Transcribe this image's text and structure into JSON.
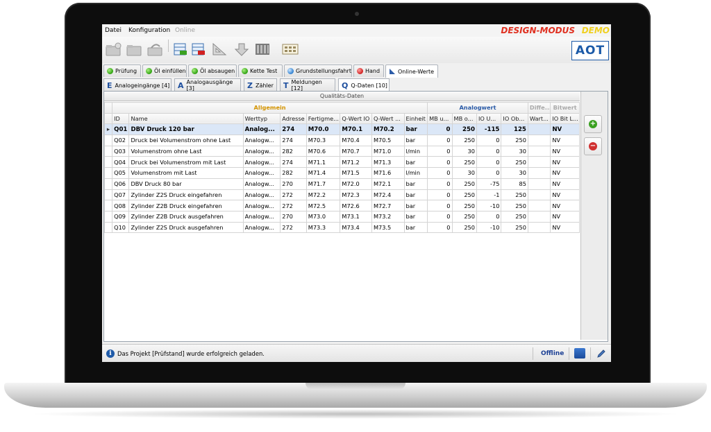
{
  "menu": {
    "items": [
      "Datei",
      "Konfiguration",
      "Online"
    ]
  },
  "mode": {
    "design": "DESIGN-MODUS",
    "demo": "DEMO"
  },
  "logo": {
    "text": "AOT"
  },
  "tabs": [
    "Prüfung",
    "Öl einfüllen",
    "Öl absaugen",
    "Kette Test",
    "Grundstellungsfahrt",
    "Hand",
    "Online-Werte"
  ],
  "subtabs": [
    {
      "glyph": "E",
      "label": "Analogeingänge [4]"
    },
    {
      "glyph": "A",
      "label": "Analogausgänge [3]"
    },
    {
      "glyph": "Z",
      "label": "Zähler"
    },
    {
      "glyph": "T",
      "label": "Meldungen [12]"
    },
    {
      "glyph": "Q",
      "label": "Q-Daten [10]"
    }
  ],
  "grid": {
    "title": "Qualitäts-Daten",
    "groups": {
      "allgemein": "Allgemein",
      "analogwert": "Analogwert",
      "differenz": "Diffe...",
      "bitwert": "Bitwert"
    },
    "columns": [
      "ID",
      "Name",
      "Werttyp",
      "Adresse",
      "Fertigme...",
      "Q-Wert IO",
      "Q-Wert ...",
      "Einheit",
      "MB u...",
      "MB o...",
      "IO U...",
      "IO Ob...",
      "Wart...",
      "IO Bit L..."
    ],
    "rows": [
      [
        "Q01",
        "DBV Druck 120 bar",
        "Analog...",
        "274",
        "M70.0",
        "M70.1",
        "M70.2",
        "bar",
        "0",
        "250",
        "-115",
        "125",
        "",
        "NV"
      ],
      [
        "Q02",
        "Druck bei Volumenstrom ohne Last",
        "Analogw...",
        "274",
        "M70.3",
        "M70.4",
        "M70.5",
        "bar",
        "0",
        "250",
        "0",
        "250",
        "",
        "NV"
      ],
      [
        "Q03",
        "Volumenstrom ohne Last",
        "Analogw...",
        "282",
        "M70.6",
        "M70.7",
        "M71.0",
        "l/min",
        "0",
        "30",
        "0",
        "30",
        "",
        "NV"
      ],
      [
        "Q04",
        "Druck bei Volumenstrom mit Last",
        "Analogw...",
        "274",
        "M71.1",
        "M71.2",
        "M71.3",
        "bar",
        "0",
        "250",
        "0",
        "250",
        "",
        "NV"
      ],
      [
        "Q05",
        "Volumenstrom mit Last",
        "Analogw...",
        "282",
        "M71.4",
        "M71.5",
        "M71.6",
        "l/min",
        "0",
        "30",
        "0",
        "30",
        "",
        "NV"
      ],
      [
        "Q06",
        "DBV Druck 80 bar",
        "Analogw...",
        "270",
        "M71.7",
        "M72.0",
        "M72.1",
        "bar",
        "0",
        "250",
        "-75",
        "85",
        "",
        "NV"
      ],
      [
        "Q07",
        "Zylinder Z2S Druck eingefahren",
        "Analogw...",
        "272",
        "M72.2",
        "M72.3",
        "M72.4",
        "bar",
        "0",
        "250",
        "-1",
        "250",
        "",
        "NV"
      ],
      [
        "Q08",
        "Zylinder Z2B Druck eingefahren",
        "Analogw...",
        "272",
        "M72.5",
        "M72.6",
        "M72.7",
        "bar",
        "0",
        "250",
        "-10",
        "250",
        "",
        "NV"
      ],
      [
        "Q09",
        "Zylinder Z2B Druck ausgefahren",
        "Analogw...",
        "270",
        "M73.0",
        "M73.1",
        "M73.2",
        "bar",
        "0",
        "250",
        "0",
        "250",
        "",
        "NV"
      ],
      [
        "Q10",
        "Zylinder Z2S Druck ausgefahren",
        "Analogw...",
        "272",
        "M73.3",
        "M73.4",
        "M73.5",
        "bar",
        "0",
        "250",
        "-10",
        "250",
        "",
        "NV"
      ]
    ]
  },
  "status": {
    "message": "Das Projekt [Prüfstand] wurde erfolgreich geladen.",
    "connection": "Offline"
  },
  "colors": {
    "design_mode": "#e03020",
    "demo": "#f0d020",
    "accent": "#1b5aa8",
    "selected_row": "#dbe7f7"
  }
}
